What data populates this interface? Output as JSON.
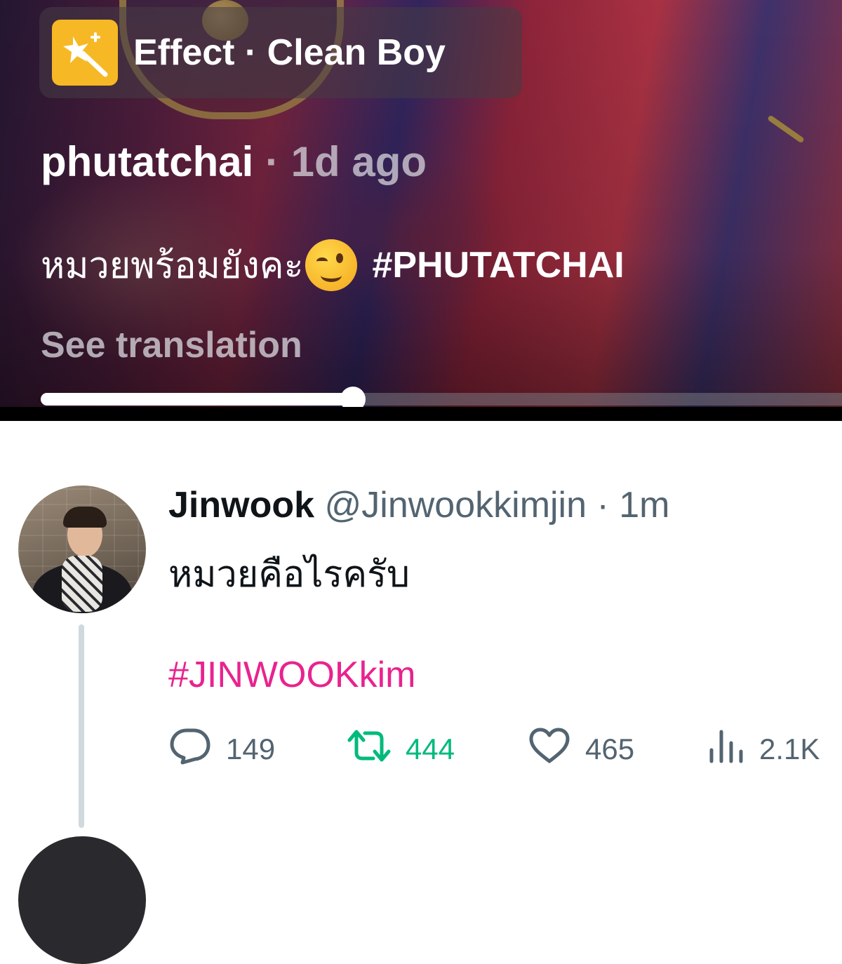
{
  "video": {
    "effect_label": "Effect · Clean Boy",
    "author": "phutatchai",
    "time_ago": " · 1d ago",
    "caption_text": "หมวยพร้อมยังคะ",
    "caption_emoji": "winking-face",
    "caption_hashtag": "#PHUTATCHAI",
    "see_translation": "See translation",
    "progress": 0.39
  },
  "tweet": {
    "display_name": "Jinwook",
    "handle": "@Jinwookkimjin",
    "time": " · 1m",
    "text": "หมวยคือไรครับ",
    "hashtag": "#JINWOOKkim",
    "actions": {
      "replies": "149",
      "retweets": "444",
      "likes": "465",
      "views": "2.1K"
    }
  },
  "colors": {
    "hashtag": "#e8238f",
    "retweet": "#00ba7c",
    "secondary": "#536471",
    "effect_icon": "#f6b824"
  }
}
